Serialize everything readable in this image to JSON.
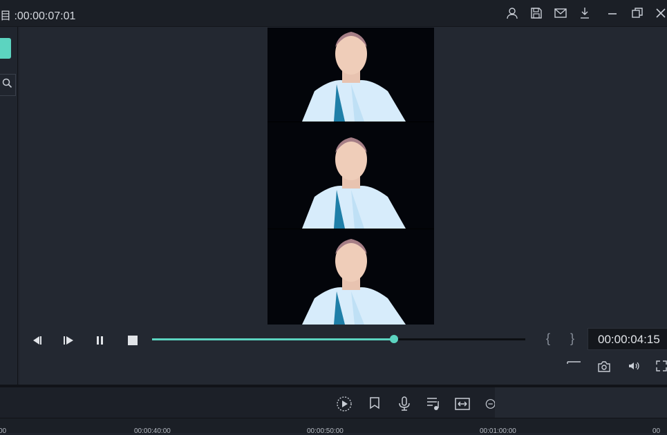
{
  "window": {
    "title": "目 :00:00:07:01",
    "icons": [
      "user-icon",
      "save-icon",
      "mail-icon",
      "download-icon",
      "minimize-icon",
      "restore-icon",
      "close-icon"
    ]
  },
  "player": {
    "timecode": "00:00:04:15",
    "progress": 0.648,
    "brackets": "{ }",
    "buttons": [
      "previous-frame-icon",
      "play-icon",
      "pause-icon",
      "stop-icon"
    ],
    "extra_icons": [
      "display-icon",
      "snapshot-icon",
      "volume-icon",
      "fullscreen-icon"
    ]
  },
  "toolbar": {
    "icons": [
      "render-preview-icon",
      "marker-icon",
      "microphone-icon",
      "audio-mixer-icon",
      "fit-timeline-icon",
      "zoom-icon"
    ]
  },
  "ruler": {
    "labels": [
      "00:00:40:00",
      "00:00:50:00",
      "00:01:00:00"
    ]
  },
  "colors": {
    "accent": "#5cd4c0",
    "background": "#1f232c",
    "panel": "#232831"
  }
}
